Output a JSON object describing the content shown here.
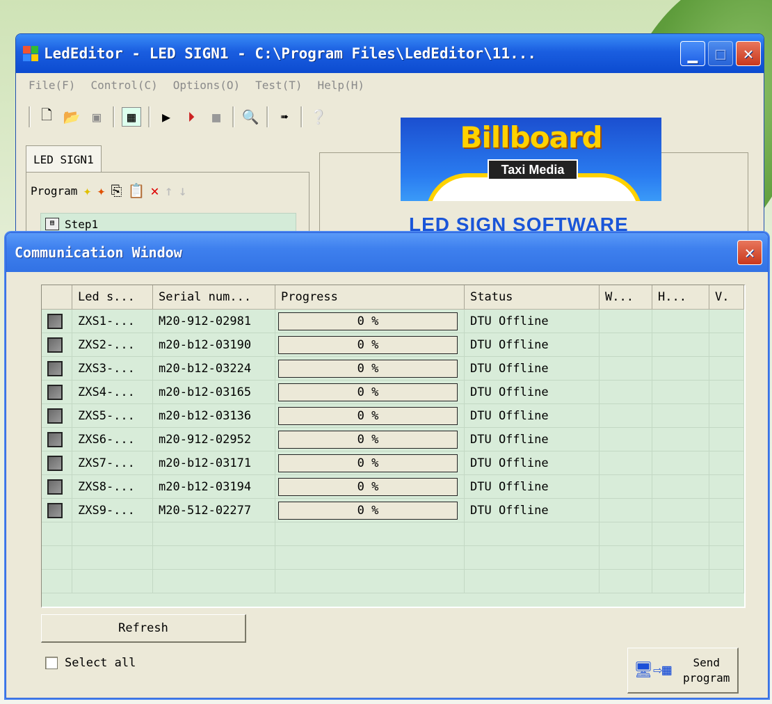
{
  "main_window": {
    "title": "LedEditor - LED SIGN1 - C:\\Program Files\\LedEditor\\11...",
    "menu": [
      "File(F)",
      "Control(C)",
      "Options(O)",
      "Test(T)",
      "Help(H)"
    ],
    "toolbar_icons": [
      "new-icon",
      "open-icon",
      "save-icon",
      "grid-icon",
      "play-icon",
      "step-icon",
      "stop-icon",
      "zoom-icon",
      "export-icon",
      "help-icon"
    ],
    "sign_tab": "LED SIGN1",
    "program_label": "Program",
    "step_label": "Step1",
    "banner": {
      "brand": "Billboard",
      "tagline": "Taxi Media",
      "subtitle": "LED SIGN SOFTWARE"
    }
  },
  "comm_window": {
    "title": "Communication Window",
    "columns": [
      "",
      "Led s...",
      "Serial num...",
      "Progress",
      "Status",
      "W...",
      "H...",
      "V."
    ],
    "rows": [
      {
        "led": "ZXS1-...",
        "serial": "M20-912-02981",
        "progress": "0 %",
        "status": "DTU Offline"
      },
      {
        "led": "ZXS2-...",
        "serial": "m20-b12-03190",
        "progress": "0 %",
        "status": "DTU Offline"
      },
      {
        "led": "ZXS3-...",
        "serial": "m20-b12-03224",
        "progress": "0 %",
        "status": "DTU Offline"
      },
      {
        "led": "ZXS4-...",
        "serial": "m20-b12-03165",
        "progress": "0 %",
        "status": "DTU Offline"
      },
      {
        "led": "ZXS5-...",
        "serial": "m20-b12-03136",
        "progress": "0 %",
        "status": "DTU Offline"
      },
      {
        "led": "ZXS6-...",
        "serial": "m20-912-02952",
        "progress": "0 %",
        "status": "DTU Offline"
      },
      {
        "led": "ZXS7-...",
        "serial": "m20-b12-03171",
        "progress": "0 %",
        "status": "DTU Offline"
      },
      {
        "led": "ZXS8-...",
        "serial": "m20-b12-03194",
        "progress": "0 %",
        "status": "DTU Offline"
      },
      {
        "led": "ZXS9-...",
        "serial": "M20-512-02277",
        "progress": "0 %",
        "status": "DTU Offline"
      }
    ],
    "refresh_label": "Refresh",
    "select_all_label": "Select all",
    "send_label_1": "Send",
    "send_label_2": "program"
  },
  "colors": {
    "titlebar": "#1a5ee0",
    "grid_bg": "#d8ecd9",
    "close_red": "#c8381d"
  }
}
